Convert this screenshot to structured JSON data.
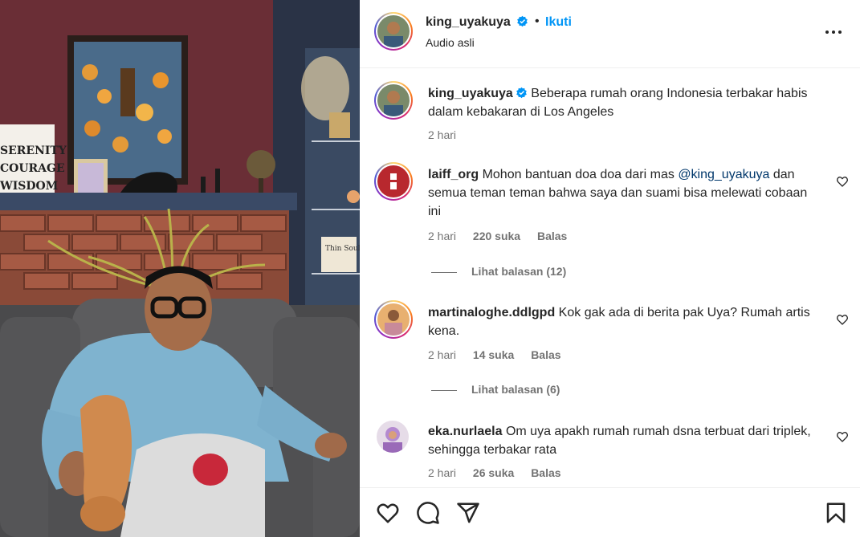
{
  "post": {
    "username": "king_uyakuya",
    "separator": "•",
    "follow_label": "Ikuti",
    "audio_label": "Audio asli"
  },
  "caption": {
    "username": "king_uyakuya",
    "text": "Beberapa rumah orang Indonesia terbakar habis dalam kebakaran di Los Angeles",
    "time": "2 hari"
  },
  "comments": [
    {
      "username": "laiff_org",
      "text_before": "Mohon bantuan doa doa dari mas ",
      "mention": "@king_uyakuya",
      "text_after": " dan semua teman teman bahwa saya dan suami bisa melewati cobaan ini",
      "time": "2 hari",
      "likes": "220 suka",
      "reply_label": "Balas",
      "view_replies": "Lihat balasan (12)"
    },
    {
      "username": "martinaloghe.ddlgpd",
      "text": "Kok gak ada di berita pak Uya? Rumah artis kena.",
      "time": "2 hari",
      "likes": "14 suka",
      "reply_label": "Balas",
      "view_replies": "Lihat balasan (6)"
    },
    {
      "username": "eka.nurlaela",
      "text": "Om uya apakh rumah rumah dsna terbuat dari triplek, sehingga terbakar rata",
      "time": "2 hari",
      "likes": "26 suka",
      "reply_label": "Balas"
    }
  ],
  "media": {
    "sign_lines": [
      "SERENITY",
      "COURAGE",
      "WISDOM"
    ],
    "small_sign": "Thin Soul"
  },
  "icons": {
    "verified": "verified-badge-icon",
    "more": "more-options-icon",
    "like": "heart-icon",
    "comment": "comment-icon",
    "share": "share-icon",
    "save": "bookmark-icon"
  },
  "colors": {
    "accent": "#0095f6",
    "verified": "#0095f6",
    "muted": "#737373",
    "mention": "#00376b"
  }
}
